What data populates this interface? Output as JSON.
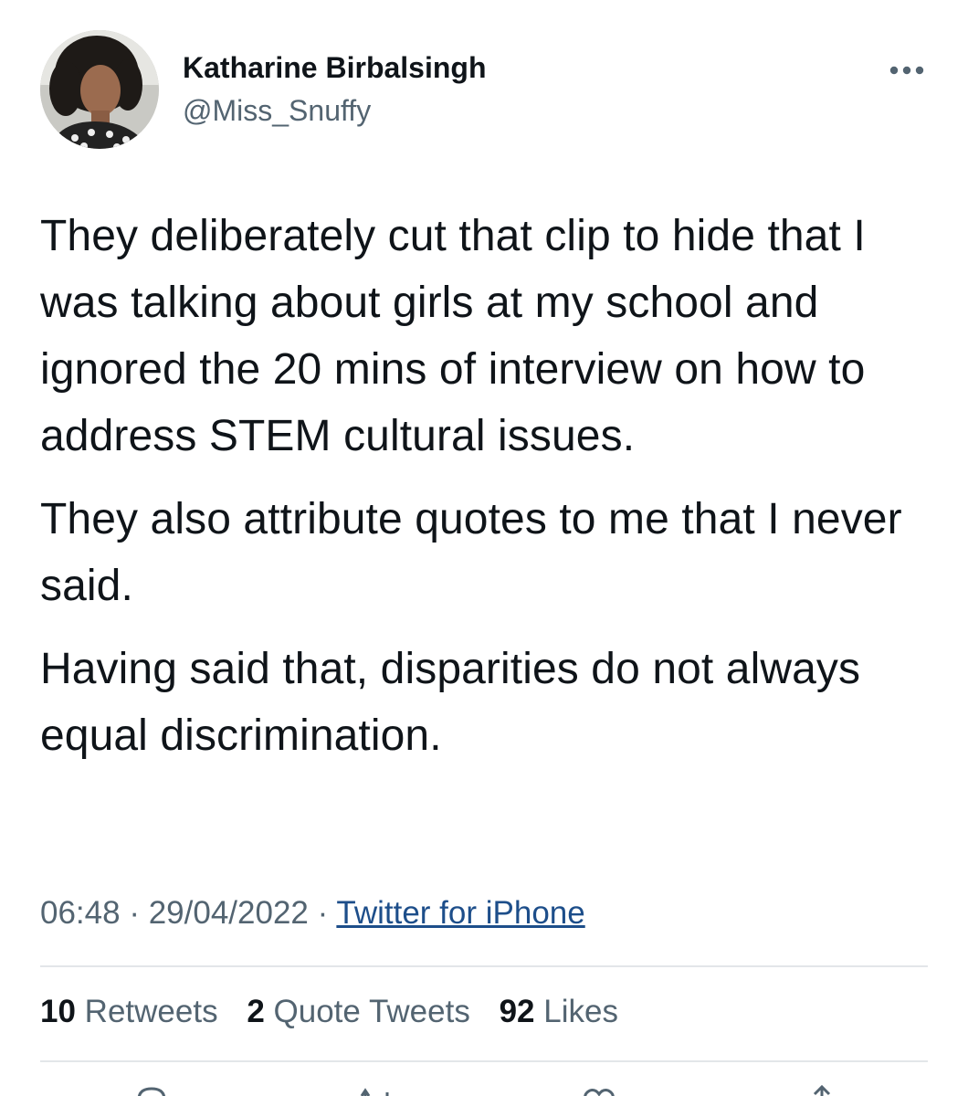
{
  "author": {
    "name": "Katharine Birbalsingh",
    "handle": "@Miss_Snuffy"
  },
  "tweet": {
    "paragraphs": [
      "They deliberately cut that clip to hide that I was talking about girls at my school and ignored the 20 mins of interview on how to address STEM cultural issues.",
      "They also attribute quotes to me that I never said.",
      "Having said that, disparities do not always equal discrimination."
    ]
  },
  "meta": {
    "time": "06:48",
    "separator": "·",
    "date": "29/04/2022",
    "source": "Twitter for iPhone"
  },
  "stats": {
    "retweets_count": "10",
    "retweets_label": "Retweets",
    "quotes_count": "2",
    "quotes_label": "Quote Tweets",
    "likes_count": "92",
    "likes_label": "Likes"
  },
  "icons": {
    "more": "more-horizontal-icon",
    "reply": "reply-icon",
    "retweet": "retweet-icon",
    "like": "heart-icon",
    "share": "share-icon"
  },
  "colors": {
    "text": "#0f1419",
    "secondary": "#536471",
    "link": "#1d4e8a",
    "divider": "#e3e6e9"
  }
}
